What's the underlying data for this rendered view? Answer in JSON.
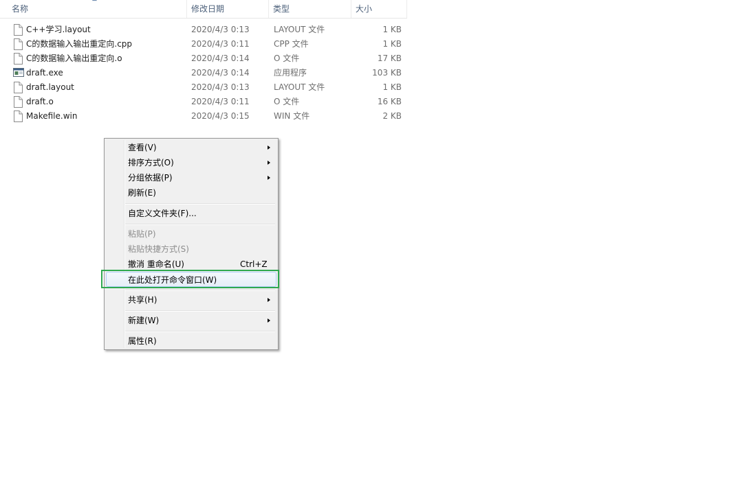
{
  "columns": {
    "name": "名称",
    "date": "修改日期",
    "type": "类型",
    "size": "大小"
  },
  "files": [
    {
      "name": "C++学习.layout",
      "date": "2020/4/3 0:13",
      "type": "LAYOUT 文件",
      "size": "1 KB",
      "icon": "file-icon"
    },
    {
      "name": "C的数据输入输出重定向.cpp",
      "date": "2020/4/3 0:11",
      "type": "CPP 文件",
      "size": "1 KB",
      "icon": "file-icon"
    },
    {
      "name": "C的数据输入输出重定向.o",
      "date": "2020/4/3 0:14",
      "type": "O 文件",
      "size": "17 KB",
      "icon": "file-icon"
    },
    {
      "name": "draft.exe",
      "date": "2020/4/3 0:14",
      "type": "应用程序",
      "size": "103 KB",
      "icon": "exe-icon"
    },
    {
      "name": "draft.layout",
      "date": "2020/4/3 0:13",
      "type": "LAYOUT 文件",
      "size": "1 KB",
      "icon": "file-icon"
    },
    {
      "name": "draft.o",
      "date": "2020/4/3 0:11",
      "type": "O 文件",
      "size": "16 KB",
      "icon": "file-icon"
    },
    {
      "name": "Makefile.win",
      "date": "2020/4/3 0:15",
      "type": "WIN 文件",
      "size": "2 KB",
      "icon": "file-icon"
    }
  ],
  "menu": {
    "view": "查看(V)",
    "sort_by": "排序方式(O)",
    "group_by": "分组依据(P)",
    "refresh": "刷新(E)",
    "customize": "自定义文件夹(F)...",
    "paste": "粘贴(P)",
    "paste_shortcut": "粘贴快捷方式(S)",
    "undo_rename": "撤消 重命名(U)",
    "undo_shortcut": "Ctrl+Z",
    "open_cmd": "在此处打开命令窗口(W)",
    "share": "共享(H)",
    "new": "新建(W)",
    "properties": "属性(R)"
  },
  "colors": {
    "highlight_border": "#2fa84f",
    "menu_hover_border": "#aecff7"
  }
}
